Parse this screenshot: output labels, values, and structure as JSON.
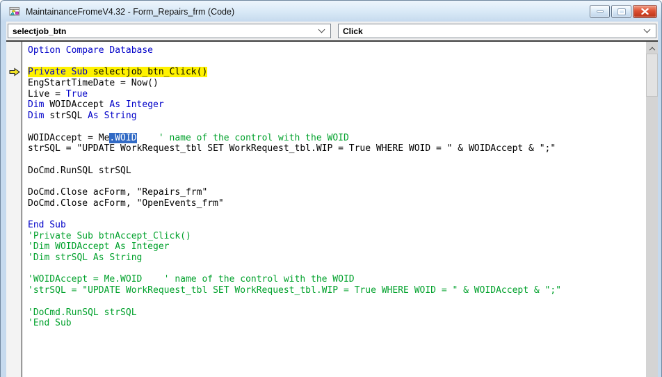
{
  "window": {
    "title": "MaintainanceFromeV4.32 - Form_Repairs_frm (Code)",
    "icon": "vba-form-icon",
    "controls": [
      "minimize",
      "maximize",
      "close"
    ]
  },
  "combos": {
    "object_selected": "selectjob_btn",
    "procedure_selected": "Click"
  },
  "colors": {
    "keyword": "#0000C8",
    "comment": "#00A12B",
    "selection": "#316AC5",
    "exec-highlight": "#FFF200",
    "exec-arrow": "#F2E326",
    "close-button": "#C63A22",
    "titlebar": "#D8E7F5"
  },
  "icons": {
    "execution_arrow": "yellow-right-arrow",
    "dropdown": "chevron-down",
    "scroll_up": "chevron-up"
  },
  "code": {
    "lines": [
      {
        "seg": [
          {
            "c": "k",
            "t": "Option Compare Database"
          }
        ]
      },
      {
        "seg": []
      },
      {
        "hl": true,
        "arrow": true,
        "seg": [
          {
            "c": "k",
            "t": "Private Sub "
          },
          {
            "c": "n",
            "t": "selectjob_btn_Click()"
          }
        ]
      },
      {
        "seg": [
          {
            "c": "n",
            "t": "EngStartTimeDate = Now()"
          }
        ]
      },
      {
        "seg": [
          {
            "c": "n",
            "t": "Live = "
          },
          {
            "c": "k",
            "t": "True"
          }
        ]
      },
      {
        "seg": [
          {
            "c": "k",
            "t": "Dim "
          },
          {
            "c": "n",
            "t": "WOIDAccept "
          },
          {
            "c": "k",
            "t": "As Integer"
          }
        ]
      },
      {
        "seg": [
          {
            "c": "k",
            "t": "Dim "
          },
          {
            "c": "n",
            "t": "strSQL "
          },
          {
            "c": "k",
            "t": "As String"
          }
        ]
      },
      {
        "seg": []
      },
      {
        "seg": [
          {
            "c": "n",
            "t": "WOIDAccept = Me"
          },
          {
            "c": "s",
            "t": ".WOID"
          },
          {
            "c": "n",
            "t": "    "
          },
          {
            "c": "c",
            "t": "' name of the control with the WOID"
          }
        ]
      },
      {
        "seg": [
          {
            "c": "n",
            "t": "strSQL = \"UPDATE WorkRequest_tbl SET WorkRequest_tbl.WIP = True WHERE WOID = \" & WOIDAccept & \";\""
          }
        ]
      },
      {
        "seg": []
      },
      {
        "seg": [
          {
            "c": "n",
            "t": "DoCmd.RunSQL strSQL"
          }
        ]
      },
      {
        "seg": []
      },
      {
        "seg": [
          {
            "c": "n",
            "t": "DoCmd.Close acForm, \"Repairs_frm\""
          }
        ]
      },
      {
        "seg": [
          {
            "c": "n",
            "t": "DoCmd.Close acForm, \"OpenEvents_frm\""
          }
        ]
      },
      {
        "seg": []
      },
      {
        "seg": [
          {
            "c": "k",
            "t": "End Sub"
          }
        ]
      },
      {
        "seg": [
          {
            "c": "c",
            "t": "'Private Sub btnAccept_Click()"
          }
        ]
      },
      {
        "seg": [
          {
            "c": "c",
            "t": "'Dim WOIDAccept As Integer"
          }
        ]
      },
      {
        "seg": [
          {
            "c": "c",
            "t": "'Dim strSQL As String"
          }
        ]
      },
      {
        "seg": []
      },
      {
        "seg": [
          {
            "c": "c",
            "t": "'WOIDAccept = Me.WOID    ' name of the control with the WOID"
          }
        ]
      },
      {
        "seg": [
          {
            "c": "c",
            "t": "'strSQL = \"UPDATE WorkRequest_tbl SET WorkRequest_tbl.WIP = True WHERE WOID = \" & WOIDAccept & \";\""
          }
        ]
      },
      {
        "seg": []
      },
      {
        "seg": [
          {
            "c": "c",
            "t": "'DoCmd.RunSQL strSQL"
          }
        ]
      },
      {
        "seg": [
          {
            "c": "c",
            "t": "'End Sub"
          }
        ]
      }
    ]
  }
}
